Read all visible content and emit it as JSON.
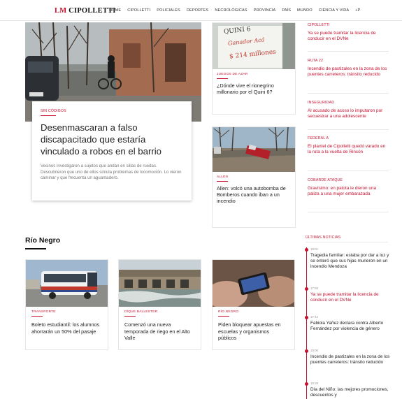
{
  "nav": {
    "brand_prefix": "LM",
    "brand_name": "CIPOLLETTI",
    "items": [
      "HOME",
      "CIPOLLETTI",
      "POLICIALES",
      "DEPORTES",
      "NECROLÓGICAS",
      "PROVINCIA",
      "PAÍS",
      "MUNDO",
      "CIENCIA Y VIDA",
      "+P"
    ]
  },
  "hero": {
    "kicker": "SIN CÓDIGOS",
    "title": "Desenmascaran a falso discapacitado que estaría vinculado a robos en el barrio",
    "lead": "Vecinos investigaron a sujetos que andan en sillas de ruedas. Descubrieron que uno de ellos simula problemas de locomoción. Lo vieron caminar y que frecuenta un aguantadero."
  },
  "middle": [
    {
      "kicker": "JUEGOS DE AZAR",
      "title": "¿Dónde vive el rionegrino millonario por el Quini 6?",
      "sign": {
        "line1": "QUINI 6",
        "line2": "Ganador Acá",
        "line3": "$ 214 millones"
      }
    },
    {
      "kicker": "ALLEN",
      "title": "Allen: volcó una autobomba de Bomberos cuando iban a un incendio"
    }
  ],
  "right": [
    {
      "category": "CIPOLLETTI",
      "title": "Ya se puede tramitar la licencia de conducir en el DVNe"
    },
    {
      "category": "RUTA 22",
      "title": "Incendio de pastizales en la zona de los puentes carreteros: tránsito reducido"
    },
    {
      "category": "INSEGURIDAD",
      "title": "Al acusado de acoso lo imputaron por secuestrar a una adolescente"
    },
    {
      "category": "FEDERAL A",
      "title": "El plantel de Cipolletti quedó varado en la ruta a la vuelta de Rincón"
    },
    {
      "category": "COBARDE ATAQUE",
      "title": "Gravísimo: en patota le dieron una paliza a una mujer embarazada"
    }
  ],
  "section": {
    "title": "Río Negro",
    "cards": [
      {
        "kicker": "TRANSPORTE",
        "title": "Boleto estudiantil: los alumnos ahorrarán un 50% del pasaje"
      },
      {
        "kicker": "DIQUE BALLESTER",
        "title": "Comenzó una nueva temporada de riego en el Alto Valle"
      },
      {
        "kicker": "RÍO NEGRO",
        "title": "Piden bloquear apuestas en escuelas y organismos públicos"
      }
    ]
  },
  "latest": {
    "heading": "ÚLTIMAS NOTICIAS",
    "items": [
      {
        "time": "18:01",
        "title": "Tragedia familiar: estaba por dar a luz y se enteró que sus hijas murieron en un incendio Mendoza"
      },
      {
        "time": "17:55",
        "title": "Ya se puede tramitar la licencia de conducir en el DVNe"
      },
      {
        "time": "17:42",
        "title": "Fabiola Yañez declara contra Alberto Fernández por violencia de género"
      },
      {
        "time": "18:00",
        "title": "Incendio de pastizales en la zona de los puentes carreteros: tránsito reducido"
      },
      {
        "time": "18:29",
        "title": "Día del Niño: las mejores promociones, descuentos y"
      }
    ]
  },
  "colors": {
    "accent": "#c8102e",
    "text": "#222222",
    "muted": "#777777"
  }
}
